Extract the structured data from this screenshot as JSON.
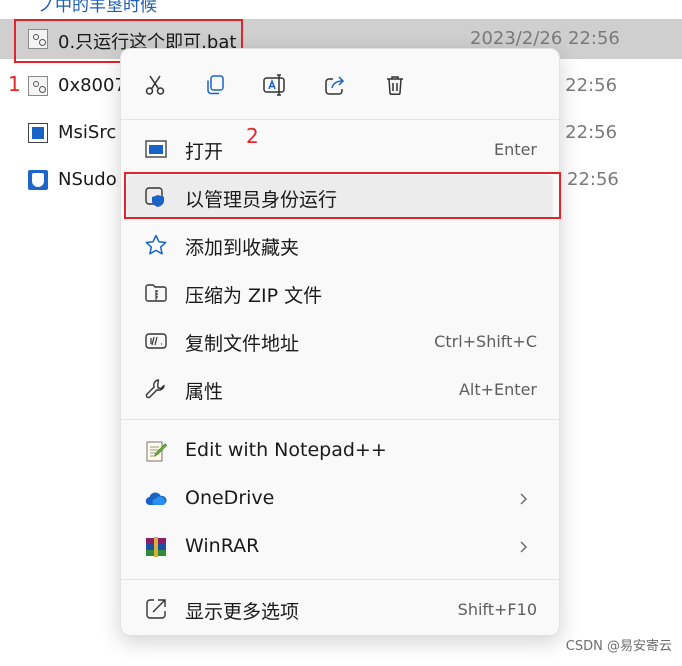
{
  "breadcrumb": {
    "label": "ノ中的羊垦时候"
  },
  "files": [
    {
      "name": "0.只运行这个即可.bat",
      "date": "2023/2/26 22:56"
    },
    {
      "name": "0x8007",
      "date": "6 22:56"
    },
    {
      "name": "MsiSrc",
      "date": "6 22:56"
    },
    {
      "name": "NSudo",
      "date": "22:56"
    }
  ],
  "annotations": {
    "step1": "1",
    "step2": "2"
  },
  "quick_actions": [
    {
      "icon": "scissors-icon",
      "label": "剪切"
    },
    {
      "icon": "copy-icon",
      "label": "复制"
    },
    {
      "icon": "rename-icon",
      "label": "重命名"
    },
    {
      "icon": "share-icon",
      "label": "共享"
    },
    {
      "icon": "delete-icon",
      "label": "删除"
    }
  ],
  "menu": {
    "open": {
      "label": "打开",
      "shortcut": "Enter"
    },
    "run_as_admin": {
      "label": "以管理员身份运行"
    },
    "favorite": {
      "label": "添加到收藏夹"
    },
    "zip": {
      "label": "压缩为 ZIP 文件"
    },
    "copy_path": {
      "label": "复制文件地址",
      "shortcut": "Ctrl+Shift+C"
    },
    "properties": {
      "label": "属性",
      "shortcut": "Alt+Enter"
    },
    "notepad": {
      "label": "Edit with Notepad++"
    },
    "onedrive": {
      "label": "OneDrive"
    },
    "winrar": {
      "label": "WinRAR"
    },
    "more": {
      "label": "显示更多选项",
      "shortcut": "Shift+F10"
    }
  },
  "watermark": "CSDN @易安寄云",
  "colors": {
    "accent": "#1a63c6",
    "annotation": "#e0262b",
    "selection": "#cfcfcf"
  }
}
